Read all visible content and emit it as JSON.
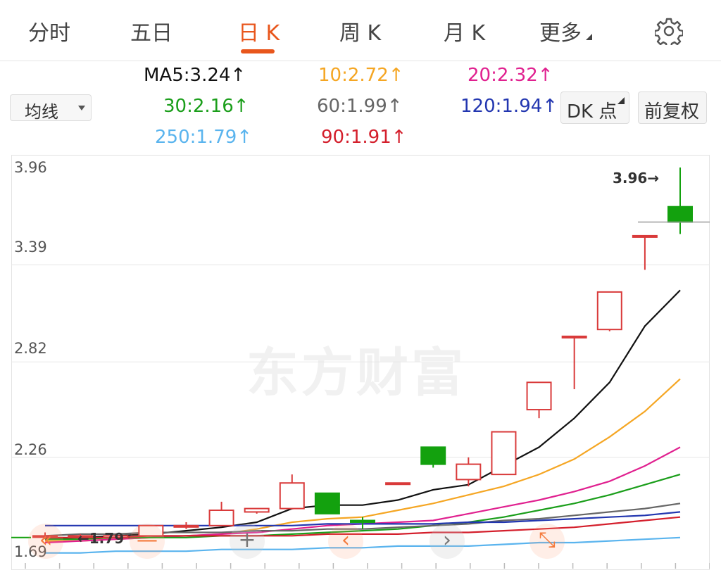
{
  "tabs": [
    {
      "label": "分时",
      "active": false
    },
    {
      "label": "五日",
      "active": false
    },
    {
      "label": "日 K",
      "active": true
    },
    {
      "label": "周 K",
      "active": false
    },
    {
      "label": "月 K",
      "active": false
    },
    {
      "label": "更多",
      "active": false
    }
  ],
  "toolbar": {
    "settings_icon": "gear-icon",
    "indicator_select": "均线",
    "dk_button": "DK 点",
    "fq_button": "前复权"
  },
  "ma": [
    {
      "label": "MA5:3.24",
      "arrow": "↑",
      "color": "#111111"
    },
    {
      "label": "10:2.72",
      "arrow": "↑",
      "color": "#f5a623"
    },
    {
      "label": "20:2.32",
      "arrow": "↑",
      "color": "#e0208f"
    },
    {
      "label": "30:2.16",
      "arrow": "↑",
      "color": "#1a9e1a"
    },
    {
      "label": "60:1.99",
      "arrow": "↑",
      "color": "#666666"
    },
    {
      "label": "120:1.94",
      "arrow": "↑",
      "color": "#2236b0"
    },
    {
      "label": "250:1.79",
      "arrow": "↑",
      "color": "#5ab4ee"
    },
    {
      "label": "90:1.91",
      "arrow": "↑",
      "color": "#d41f2c"
    }
  ],
  "chart_data": {
    "type": "candlestick",
    "y_ticks": [
      "3.96",
      "3.39",
      "2.82",
      "2.26",
      "1.69"
    ],
    "ylim": [
      1.69,
      3.96
    ],
    "max_label": "3.96→",
    "min_label": "←1.79",
    "watermark": "东方财富",
    "up_color": "#d93a3a",
    "down_color": "#13a10e",
    "candles": [
      {
        "o": 1.8,
        "c": 1.8,
        "h": 1.82,
        "l": 1.78
      },
      {
        "o": 1.8,
        "c": 1.8,
        "h": 1.81,
        "l": 1.79
      },
      {
        "o": 1.79,
        "c": 1.8,
        "h": 1.81,
        "l": 1.79
      },
      {
        "o": 1.8,
        "c": 1.86,
        "h": 1.86,
        "l": 1.8
      },
      {
        "o": 1.86,
        "c": 1.86,
        "h": 1.88,
        "l": 1.84
      },
      {
        "o": 1.86,
        "c": 1.95,
        "h": 2.0,
        "l": 1.86
      },
      {
        "o": 1.94,
        "c": 1.96,
        "h": 1.96,
        "l": 1.93
      },
      {
        "o": 1.96,
        "c": 2.11,
        "h": 2.16,
        "l": 1.96
      },
      {
        "o": 2.05,
        "c": 1.93,
        "h": 2.05,
        "l": 1.93
      },
      {
        "o": 1.89,
        "c": 1.88,
        "h": 1.91,
        "l": 1.84
      },
      {
        "o": 2.11,
        "c": 2.11,
        "h": 2.11,
        "l": 2.11
      },
      {
        "o": 2.32,
        "c": 2.22,
        "h": 2.32,
        "l": 2.2
      },
      {
        "o": 2.13,
        "c": 2.22,
        "h": 2.26,
        "l": 2.09
      },
      {
        "o": 2.16,
        "c": 2.41,
        "h": 2.41,
        "l": 2.16
      },
      {
        "o": 2.54,
        "c": 2.7,
        "h": 2.7,
        "l": 2.49
      },
      {
        "o": 2.97,
        "c": 2.97,
        "h": 2.97,
        "l": 2.66
      },
      {
        "o": 3.01,
        "c": 3.23,
        "h": 3.23,
        "l": 3.0
      },
      {
        "o": 3.56,
        "c": 3.56,
        "h": 3.56,
        "l": 3.36
      },
      {
        "o": 3.73,
        "c": 3.64,
        "h": 3.96,
        "l": 3.57
      }
    ],
    "series": [
      {
        "name": "MA5",
        "color": "#111111",
        "values": [
          1.78,
          1.79,
          1.8,
          1.81,
          1.83,
          1.85,
          1.88,
          1.96,
          1.98,
          1.98,
          2.01,
          2.07,
          2.1,
          2.21,
          2.32,
          2.49,
          2.7,
          3.03,
          3.24
        ]
      },
      {
        "name": "10",
        "color": "#f5a623",
        "values": [
          1.77,
          1.77,
          1.78,
          1.79,
          1.8,
          1.81,
          1.84,
          1.88,
          1.9,
          1.91,
          1.95,
          1.99,
          2.04,
          2.09,
          2.16,
          2.25,
          2.38,
          2.53,
          2.72
        ]
      },
      {
        "name": "20",
        "color": "#e0208f",
        "values": [
          1.76,
          1.77,
          1.78,
          1.79,
          1.8,
          1.81,
          1.82,
          1.84,
          1.86,
          1.87,
          1.88,
          1.89,
          1.93,
          1.97,
          2.01,
          2.06,
          2.12,
          2.21,
          2.32
        ]
      },
      {
        "name": "30",
        "color": "#1a9e1a",
        "values": [
          1.78,
          1.78,
          1.79,
          1.79,
          1.79,
          1.8,
          1.8,
          1.81,
          1.82,
          1.83,
          1.84,
          1.86,
          1.88,
          1.91,
          1.95,
          1.99,
          2.04,
          2.1,
          2.16
        ]
      },
      {
        "name": "60",
        "color": "#666666",
        "values": [
          1.8,
          1.81,
          1.81,
          1.82,
          1.82,
          1.82,
          1.83,
          1.83,
          1.84,
          1.84,
          1.85,
          1.86,
          1.87,
          1.89,
          1.9,
          1.92,
          1.94,
          1.96,
          1.99
        ]
      },
      {
        "name": "120",
        "color": "#2236b0",
        "values": [
          1.86,
          1.86,
          1.86,
          1.86,
          1.86,
          1.86,
          1.86,
          1.86,
          1.87,
          1.87,
          1.87,
          1.87,
          1.88,
          1.88,
          1.89,
          1.9,
          1.91,
          1.92,
          1.94
        ]
      },
      {
        "name": "90",
        "color": "#d41f2c",
        "values": [
          1.79,
          1.79,
          1.79,
          1.8,
          1.8,
          1.8,
          1.8,
          1.8,
          1.81,
          1.81,
          1.81,
          1.82,
          1.82,
          1.83,
          1.84,
          1.85,
          1.87,
          1.89,
          1.91
        ]
      },
      {
        "name": "250",
        "color": "#5ab4ee",
        "values": [
          1.7,
          1.7,
          1.71,
          1.71,
          1.71,
          1.72,
          1.72,
          1.72,
          1.73,
          1.73,
          1.74,
          1.74,
          1.74,
          1.75,
          1.76,
          1.76,
          1.77,
          1.78,
          1.79
        ]
      }
    ]
  },
  "controls": [
    {
      "name": "zoom-out-control",
      "glyph": "«",
      "icon": "double-chevron-left-icon"
    },
    {
      "name": "minus-control",
      "glyph": "—",
      "icon": "minus-icon"
    },
    {
      "name": "plus-control",
      "glyph": "+",
      "icon": "plus-icon"
    },
    {
      "name": "prev-control",
      "glyph": "‹",
      "icon": "chevron-left-icon"
    },
    {
      "name": "next-control",
      "glyph": "›",
      "icon": "chevron-right-icon"
    },
    {
      "name": "fullscreen-control",
      "glyph": "⤡",
      "icon": "expand-icon"
    }
  ]
}
